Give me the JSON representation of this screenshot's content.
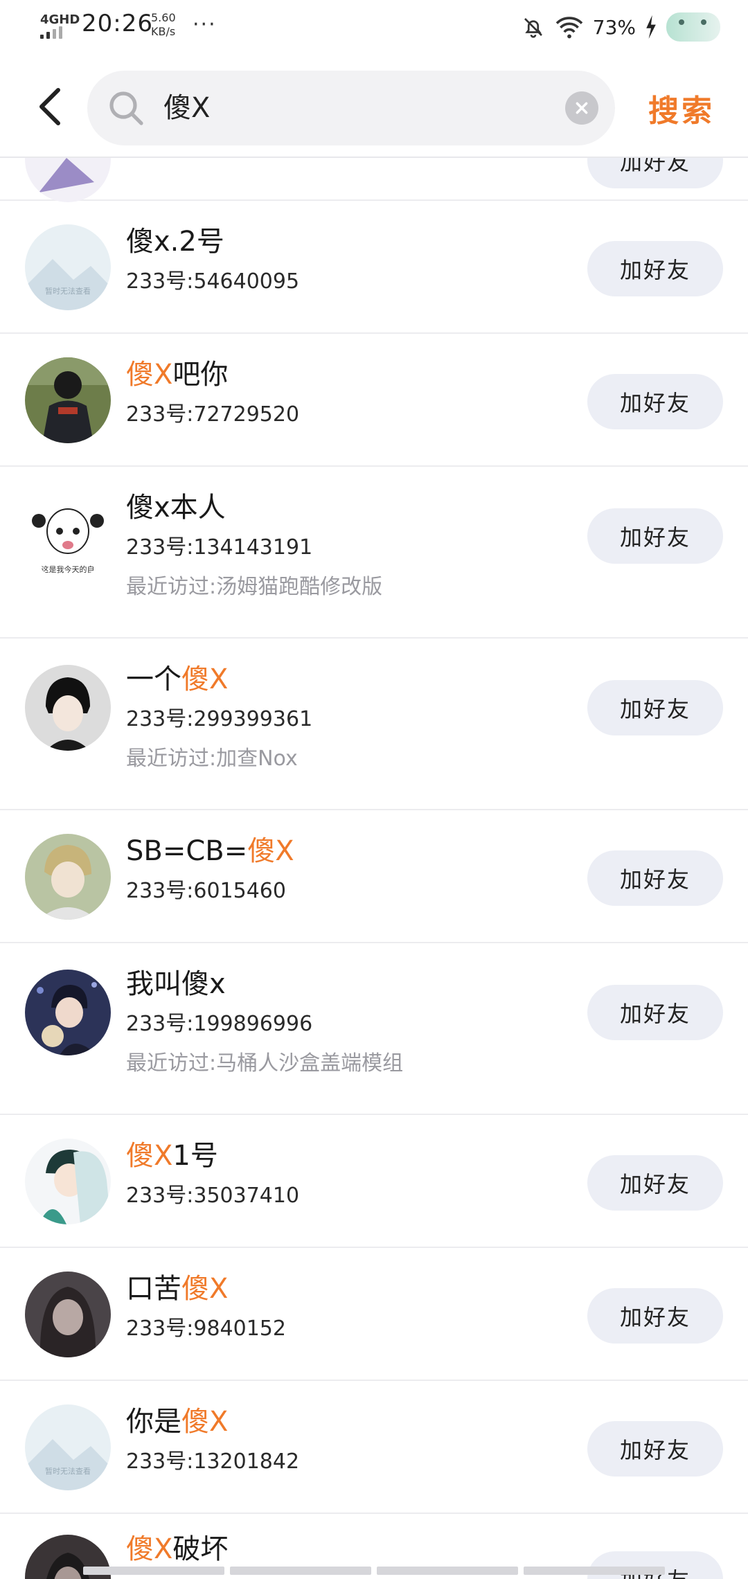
{
  "status_bar": {
    "network": "4GHD",
    "time": "20:26",
    "speed_value": "5.60",
    "speed_unit": "KB/s",
    "more": "···",
    "battery": "73%",
    "icons": [
      "bell-off-icon",
      "wifi-icon",
      "charging-icon",
      "mascot-icon"
    ]
  },
  "search": {
    "query": "傻X",
    "submit_label": "搜索",
    "accent_color": "#f07a2a"
  },
  "add_friend_label": "加好友",
  "uid_prefix": "233号:",
  "recent_prefix": "最近访过:",
  "results": [
    {
      "avatar": "purple-illustration",
      "nick_pre": "",
      "nick_hl": "",
      "nick_post": "",
      "uid": "",
      "recent": ""
    },
    {
      "avatar": "placeholder",
      "placeholder_text": "暂时无法查看",
      "nick_pre": "傻x.2号",
      "nick_hl": "",
      "nick_post": "",
      "uid": "54640095",
      "recent": ""
    },
    {
      "avatar": "cartoon-back",
      "nick_pre": "",
      "nick_hl": "傻X",
      "nick_post": "吧你",
      "uid": "72729520",
      "recent": ""
    },
    {
      "avatar": "meme-face",
      "avatar_caption": "这是我今天的自",
      "nick_pre": "傻x本人",
      "nick_hl": "",
      "nick_post": "",
      "uid": "134143191",
      "recent": "汤姆猫跑酷修改版"
    },
    {
      "avatar": "anime-black-hair",
      "nick_pre": "一个",
      "nick_hl": "傻X",
      "nick_post": "",
      "uid": "299399361",
      "recent": "加查Nox"
    },
    {
      "avatar": "anime-blonde",
      "nick_pre": "SB=CB=",
      "nick_hl": "傻X",
      "nick_post": "",
      "uid": "6015460",
      "recent": ""
    },
    {
      "avatar": "anime-dark-blue",
      "nick_pre": "我叫傻x",
      "nick_hl": "",
      "nick_post": "",
      "uid": "199896996",
      "recent": "马桶人沙盒盖端模组"
    },
    {
      "avatar": "anime-teal",
      "nick_pre": "",
      "nick_hl": "傻X",
      "nick_post": "1号",
      "uid": "35037410",
      "recent": ""
    },
    {
      "avatar": "dark-portrait",
      "nick_pre": "口苦",
      "nick_hl": "傻X",
      "nick_post": "",
      "uid": "9840152",
      "recent": ""
    },
    {
      "avatar": "placeholder",
      "placeholder_text": "暂时无法查看",
      "nick_pre": "你是",
      "nick_hl": "傻X",
      "nick_post": "",
      "uid": "13201842",
      "recent": ""
    },
    {
      "avatar": "dark-portrait-2",
      "nick_pre": "",
      "nick_hl": "傻X",
      "nick_post": "破坏",
      "uid": "",
      "recent": ""
    }
  ]
}
